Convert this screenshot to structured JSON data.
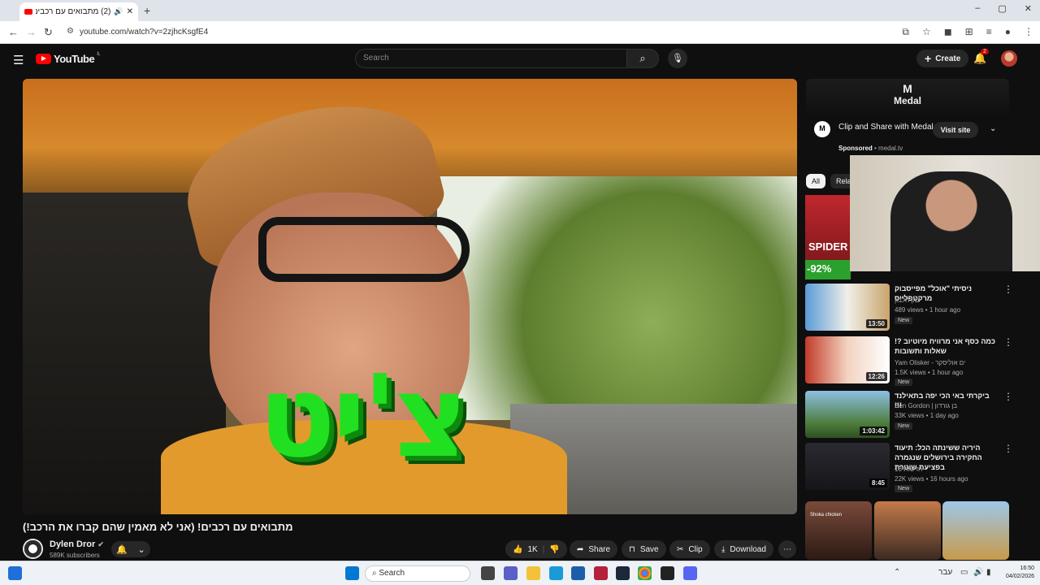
{
  "browser": {
    "tab_title": "(2) מתבואים עם רכבים! (אני",
    "new_tab": "+",
    "url": "youtube.com/watch?v=2zjhcKsgfE4",
    "window_controls": [
      "–",
      "▢",
      "✕"
    ]
  },
  "youtube": {
    "logo_text": "YouTube",
    "region": "IL",
    "search_placeholder": "Search",
    "create_label": "Create",
    "notification_count": "2"
  },
  "video": {
    "overlay_text": "צ'יט",
    "title": "מתבואים עם רכבים! (אני לא מאמין שהם קברו את הרכב!)",
    "channel": "Dylen Dror",
    "subscribers": "589K subscribers",
    "likes": "1K",
    "actions": {
      "share": "Share",
      "save": "Save",
      "clip": "Clip",
      "download": "Download"
    }
  },
  "ad": {
    "brand": "Medal",
    "headline": "Clip and Share with Medal",
    "sponsored": "Sponsored",
    "domain": "medal.tv",
    "visit_label": "Visit site"
  },
  "chips": [
    "All",
    "Rela"
  ],
  "promo": {
    "label": "SPIDER",
    "discount": "-92%"
  },
  "recommendations": [
    {
      "title": "ניסיתי \"אוכל\" מפייסבוק מרקטפלייס",
      "channel": "שון חלבון",
      "views": "489 views • 1 hour ago",
      "badge": "New",
      "duration": "13:50"
    },
    {
      "title": "כמה כסף אני מרוויח מיוטיוב ?! שאלות ותשובות",
      "channel": "Yam Olisker - ים אוליסקר",
      "views": "1.5K views • 1 hour ago",
      "badge": "New",
      "duration": "12:26"
    },
    {
      "title": "ביקרתי באי הכי יפה בתאילנד !!!",
      "channel": "Ben Gordon | בן גורדון",
      "views": "33K views • 1 day ago",
      "badge": "New",
      "duration": "1:03:42"
    },
    {
      "title": "היריה ששינתה הכל: תיעוד החקירה בירושלים שנגמרה בפציעת שוטרת",
      "channel": "חדשות 13",
      "views": "22K views • 16 hours ago",
      "badge": "New",
      "duration": "8:45"
    }
  ],
  "shorts": [
    {
      "label": "Shoka chicken"
    }
  ],
  "taskbar": {
    "search": "Search",
    "lang": "עבר",
    "time": "16:50",
    "date": "04/02/2026"
  },
  "colors": {
    "accent": "#ff0000",
    "green_text": "#21e021"
  }
}
